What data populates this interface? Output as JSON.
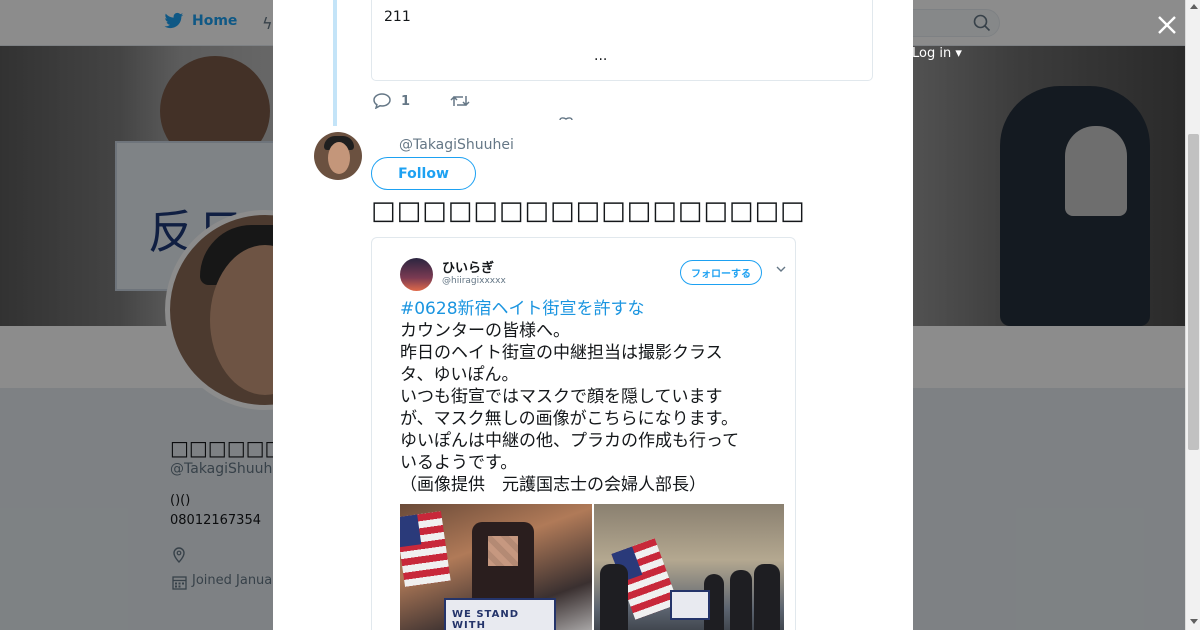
{
  "nav": {
    "home_label": "Home",
    "login_label": "Log in"
  },
  "banner": {
    "sign_text": "反日"
  },
  "profile": {
    "name": "□□□□□□□□□□",
    "handle": "@TakagiShuuh",
    "bio": "()()",
    "phone": "08012167354",
    "joined": "Joined Janua"
  },
  "modal": {
    "quoted_number": "211",
    "quoted_more": "...",
    "reply_count": "1",
    "tweet": {
      "handle": "@TakagiShuuhei",
      "follow_label": "Follow",
      "text": "□□□□□□□□□□□□□□□□□"
    },
    "embedded": {
      "name": "ひいらぎ",
      "handle": "@hiiragixxxxx",
      "follow_label": "フォローする",
      "lines": [
        "#0628新宿ヘイト街宣を許すな",
        "カウンターの皆様へ。",
        "昨日のヘイト街宣の中継担当は撮影クラス",
        "タ、ゆいぽん。",
        "いつも街宣ではマスクで顔を隠しています",
        "が、マスク無しの画像がこちらになります。",
        "ゆいぽんは中継の他、プラカの作成も行って",
        "いるようです。",
        "（画像提供　元護国志士の会婦人部長）"
      ],
      "photo_banner_text": "WE STAND WITH"
    }
  },
  "colors": {
    "accent": "#1da1f2",
    "hashtag": "#1b95e0"
  }
}
